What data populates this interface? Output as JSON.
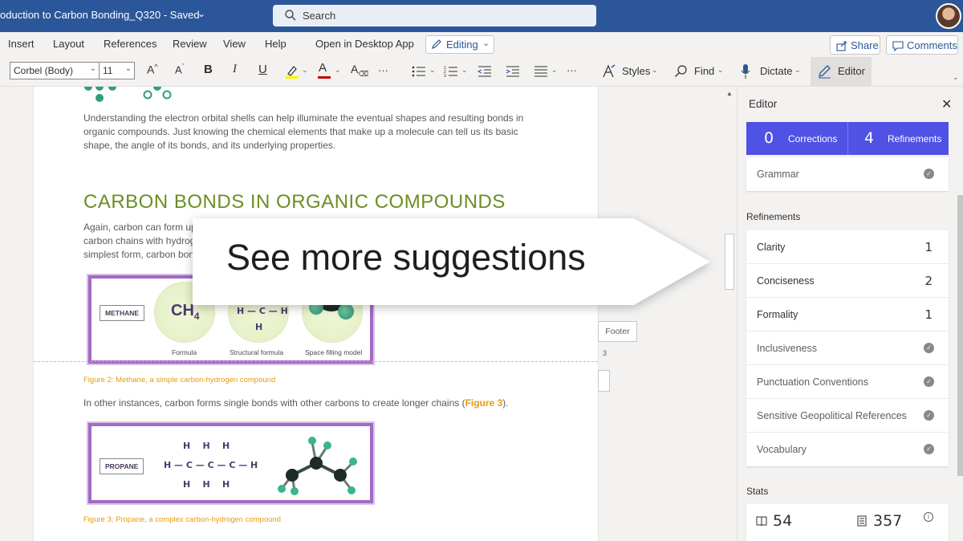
{
  "titlebar": {
    "doc_title": "oduction to Carbon Bonding_Q320",
    "separator": " - ",
    "saved": "Saved",
    "search_placeholder": "Search"
  },
  "menu": {
    "items": [
      "Insert",
      "Layout",
      "References",
      "Review",
      "View",
      "Help",
      "Open in Desktop App"
    ],
    "editing": "Editing",
    "share": "Share",
    "comments": "Comments"
  },
  "ribbon": {
    "font": "Corbel (Body)",
    "size": "11",
    "grow": "A",
    "shrink": "A",
    "bold": "B",
    "italic": "I",
    "underline": "U",
    "more": "···",
    "styles": "Styles",
    "find": "Find",
    "dictate": "Dictate",
    "editor": "Editor"
  },
  "document": {
    "para1_l1": "Understanding the electron orbital shells can help illuminate the eventual shapes and resulting bonds in",
    "para1_l2": "organic compounds. Just knowing the chemical elements that make up a molecule can tell us its basic",
    "para1_l3": "shape, the angle of its bonds, and its underlying properties.",
    "heading": "CARBON BONDS IN ORGANIC COMPOUNDS",
    "para2_l1": "Again, carbon can form up",
    "para2_l2": "carbon chains with hydrog",
    "para2_l3": "simplest form, carbon bon",
    "fig1": {
      "label": "METHANE",
      "formula": "CH",
      "formula_sub": "4",
      "struct_h_top": "H",
      "struct_mid": "H — C — H",
      "struct_h_bot": "H",
      "caption_formula": "Formula",
      "caption_structural": "Structural formula",
      "caption_space": "Space filling model"
    },
    "caption1": "Figure 2: Methane, a simple carbon-hydrogen compound",
    "para3_before": "In other instances, carbon forms single bonds with other carbons to create longer chains (",
    "para3_link": "Figure 3",
    "para3_after": ").",
    "fig2": {
      "label": "PROPANE",
      "row_top": "H    H    H",
      "row_mid": "H — C — C — C — H",
      "row_bot": "H    H    H"
    },
    "caption2": "Figure 3: Propane, a complex carbon-hydrogen compound",
    "footer_tag": "Footer",
    "page_number": "3"
  },
  "callout": {
    "text": "See more suggestions"
  },
  "editor_pane": {
    "title": "Editor",
    "corrections_count": "0",
    "corrections_label": "Corrections",
    "refinements_count": "4",
    "refinements_label": "Refinements",
    "grammar": "Grammar",
    "refinements_heading": "Refinements",
    "rows": [
      {
        "label": "Clarity",
        "value": "1"
      },
      {
        "label": "Conciseness",
        "value": "2"
      },
      {
        "label": "Formality",
        "value": "1"
      },
      {
        "label": "Inclusiveness",
        "value": ""
      },
      {
        "label": "Punctuation Conventions",
        "value": ""
      },
      {
        "label": "Sensitive Geopolitical References",
        "value": ""
      },
      {
        "label": "Vocabulary",
        "value": ""
      }
    ],
    "stats_heading": "Stats",
    "stat1": "54",
    "stat2": "357"
  },
  "colors": {
    "titlebar": "#2b579a",
    "editor_accent": "#4f52e4",
    "heading_green": "#6b8e23",
    "caption_orange": "#e69b0e",
    "figure_border": "#a26bc4"
  }
}
